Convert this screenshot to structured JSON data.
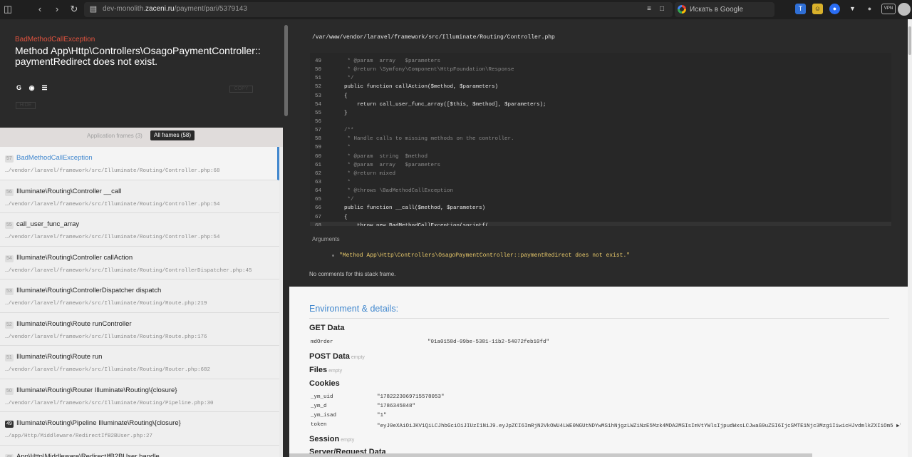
{
  "browser": {
    "url_prefix": "dev-monolith.",
    "url_domain": "zaceni.ru",
    "url_path": "/payment/pari/5379143",
    "search_placeholder": "Искать в Google",
    "vpn_label": "VPN"
  },
  "exception": {
    "name": "BadMethodCallException",
    "message": "Method App\\Http\\Controllers\\OsagoPaymentController::paymentRedirect does not exist.",
    "copy_label": "COPY",
    "hide_label": "HIDE"
  },
  "tabs": {
    "application": "Application frames (3)",
    "all": "All frames (58)"
  },
  "frames": [
    {
      "index": "57",
      "class": "BadMethodCallException",
      "file": "…/vendor/laravel/framework/src/Illuminate/Routing/Controller.php:68",
      "active": true
    },
    {
      "index": "56",
      "class": "Illuminate\\Routing\\Controller __call",
      "file": "…/vendor/laravel/framework/src/Illuminate/Routing/Controller.php:54"
    },
    {
      "index": "55",
      "class": "call_user_func_array",
      "file": "…/vendor/laravel/framework/src/Illuminate/Routing/Controller.php:54"
    },
    {
      "index": "54",
      "class": "Illuminate\\Routing\\Controller callAction",
      "file": "…/vendor/laravel/framework/src/Illuminate/Routing/ControllerDispatcher.php:45"
    },
    {
      "index": "53",
      "class": "Illuminate\\Routing\\ControllerDispatcher dispatch",
      "file": "…/vendor/laravel/framework/src/Illuminate/Routing/Route.php:219"
    },
    {
      "index": "52",
      "class": "Illuminate\\Routing\\Route runController",
      "file": "…/vendor/laravel/framework/src/Illuminate/Routing/Route.php:176"
    },
    {
      "index": "51",
      "class": "Illuminate\\Routing\\Route run",
      "file": "…/vendor/laravel/framework/src/Illuminate/Routing/Router.php:682"
    },
    {
      "index": "50",
      "class": "Illuminate\\Routing\\Router Illuminate\\Routing\\{closure}",
      "file": "…/vendor/laravel/framework/src/Illuminate/Routing/Pipeline.php:30"
    },
    {
      "index": "49",
      "class": "Illuminate\\Routing\\Pipeline Illuminate\\Routing\\{closure}",
      "file": "…/app/Http/Middleware/RedirectIfB2BUser.php:27",
      "dark": true
    },
    {
      "index": "48",
      "class": "App\\Http\\Middleware\\RedirectIfB2BUser handle",
      "file": ""
    }
  ],
  "code": {
    "file_path": "/var/www/vendor/laravel/framework/src/Illuminate/Routing/Controller.php",
    "lines": [
      {
        "n": "49",
        "t": "     * @param  array   $parameters",
        "type": "c"
      },
      {
        "n": "50",
        "t": "     * @return \\Symfony\\Component\\HttpFoundation\\Response",
        "type": "c"
      },
      {
        "n": "51",
        "t": "     */",
        "type": "c"
      },
      {
        "n": "52",
        "t": "    public function callAction($method, $parameters)",
        "type": "k"
      },
      {
        "n": "53",
        "t": "    {",
        "type": ""
      },
      {
        "n": "54",
        "t": "        return call_user_func_array([$this, $method], $parameters);",
        "type": "k"
      },
      {
        "n": "55",
        "t": "    }",
        "type": ""
      },
      {
        "n": "56",
        "t": "",
        "type": ""
      },
      {
        "n": "57",
        "t": "    /**",
        "type": "c"
      },
      {
        "n": "58",
        "t": "     * Handle calls to missing methods on the controller.",
        "type": "c"
      },
      {
        "n": "59",
        "t": "     *",
        "type": "c"
      },
      {
        "n": "60",
        "t": "     * @param  string  $method",
        "type": "c"
      },
      {
        "n": "61",
        "t": "     * @param  array   $parameters",
        "type": "c"
      },
      {
        "n": "62",
        "t": "     * @return mixed",
        "type": "c"
      },
      {
        "n": "63",
        "t": "     *",
        "type": "c"
      },
      {
        "n": "64",
        "t": "     * @throws \\BadMethodCallException",
        "type": "c"
      },
      {
        "n": "65",
        "t": "     */",
        "type": "c"
      },
      {
        "n": "66",
        "t": "    public function __call($method, $parameters)",
        "type": "k"
      },
      {
        "n": "67",
        "t": "    {",
        "type": ""
      },
      {
        "n": "68",
        "t": "        throw new BadMethodCallException(sprintf(",
        "type": "k",
        "hl": true
      }
    ],
    "arguments_label": "Arguments",
    "argument_value": "\"Method App\\Http\\Controllers\\OsagoPaymentController::paymentRedirect does not exist.\"",
    "no_comments": "No comments for this stack frame."
  },
  "environment": {
    "title": "Environment & details:",
    "get_data": {
      "label": "GET Data",
      "key": "mdOrder",
      "value": "\"01a0158d-09be-5381-11b2-54072feb10fd\""
    },
    "post_data": {
      "label": "POST Data",
      "state": "empty"
    },
    "files": {
      "label": "Files",
      "state": "empty"
    },
    "cookies": {
      "label": "Cookies",
      "rows": [
        {
          "key": "_ym_uid",
          "value": "\"1782223069715578053\""
        },
        {
          "key": "_ym_d",
          "value": "\"1786345848\""
        },
        {
          "key": "_ym_isad",
          "value": "\"1\""
        },
        {
          "key": "token",
          "value": "\"eyJ0eXAiOiJKV1QiLCJhbGciOiJIUzI1NiJ9.eyJpZCI6ImRjN2VkOWU4LWE0NGUtNDYwMS1hNjgzLWZiNzE5Mzk4MDA2MSIsImVtYWlsIjpudWxsLCJwaG9uZSI6IjcSMTE1Njc3Mzg1IiwicHJvdmlkZXIiOm5 ▶\""
        }
      ]
    },
    "session": {
      "label": "Session",
      "state": "empty"
    },
    "server": {
      "label": "Server/Request Data"
    }
  }
}
